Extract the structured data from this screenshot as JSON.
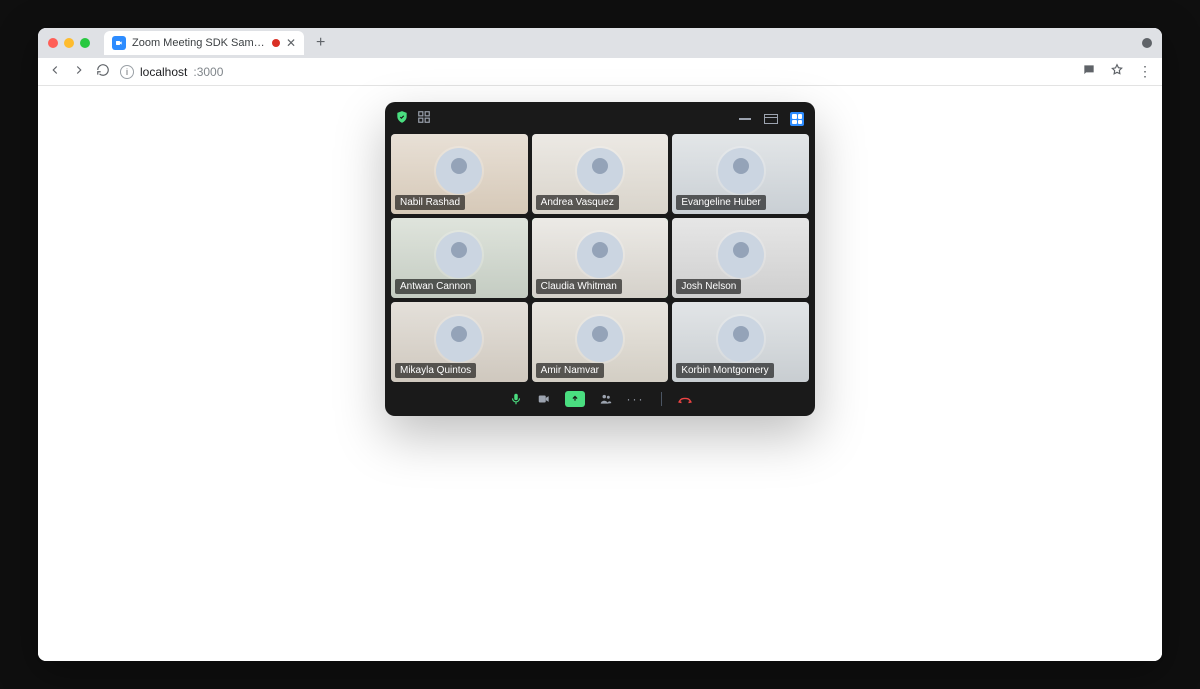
{
  "browser": {
    "tab_title": "Zoom Meeting SDK Sample",
    "url_host": "localhost",
    "url_port": ":3000"
  },
  "zoom": {
    "participants": [
      {
        "name": "Nabil Rashad",
        "active": false
      },
      {
        "name": "Andrea Vasquez",
        "active": false
      },
      {
        "name": "Evangeline Huber",
        "active": false
      },
      {
        "name": "Antwan Cannon",
        "active": false
      },
      {
        "name": "Claudia Whitman",
        "active": true
      },
      {
        "name": "Josh Nelson",
        "active": false
      },
      {
        "name": "Mikayla Quintos",
        "active": false
      },
      {
        "name": "Amir Namvar",
        "active": false
      },
      {
        "name": "Korbin Montgomery",
        "active": false
      }
    ]
  }
}
